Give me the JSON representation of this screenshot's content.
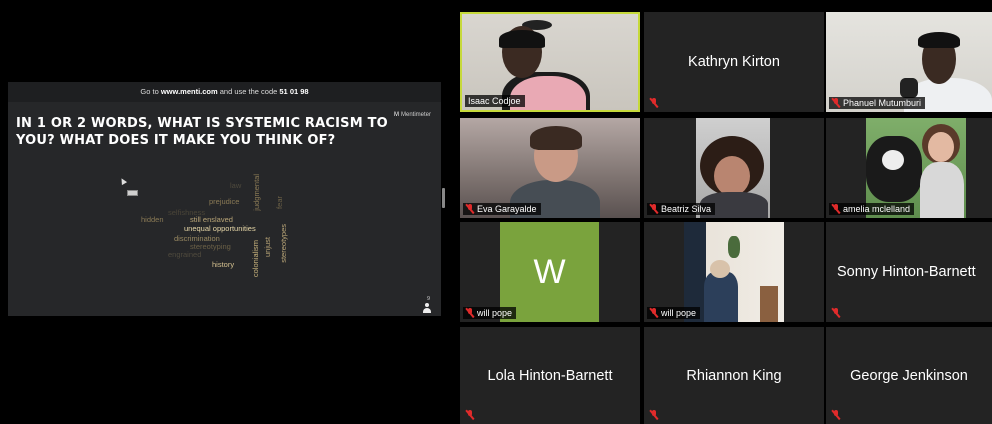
{
  "share": {
    "banner_prefix": "Go to ",
    "banner_url": "www.menti.com",
    "banner_mid": " and use the code ",
    "banner_code": "51 01 98",
    "logo_mark": "M",
    "logo_text": "Mentimeter",
    "question": "IN 1 OR 2 WORDS, WHAT IS SYSTEMIC RACISM TO YOU? WHAT DOES IT MAKE YOU THINK OF?",
    "response_count": "9",
    "word_cloud": [
      {
        "text": "law",
        "color": "#4f4a3d",
        "vertical": false
      },
      {
        "text": "prejudice",
        "color": "#8a7a55",
        "vertical": false
      },
      {
        "text": "judgmental",
        "color": "#8a7a55",
        "vertical": true
      },
      {
        "text": "fear",
        "color": "#6b6046",
        "vertical": true
      },
      {
        "text": "selfishness",
        "color": "#4a4538",
        "vertical": false
      },
      {
        "text": "hidden",
        "color": "#8a7a55",
        "vertical": false
      },
      {
        "text": "still enslaved",
        "color": "#b9a577",
        "vertical": false
      },
      {
        "text": "unequal opportunities",
        "color": "#e8d8a8",
        "vertical": false
      },
      {
        "text": "discrimination",
        "color": "#9a8a62",
        "vertical": false
      },
      {
        "text": "stereotyping",
        "color": "#6b6046",
        "vertical": false
      },
      {
        "text": "engrained",
        "color": "#4f4a3d",
        "vertical": false
      },
      {
        "text": "colonialism",
        "color": "#c8b37c",
        "vertical": true
      },
      {
        "text": "unjust",
        "color": "#b9a577",
        "vertical": true
      },
      {
        "text": "stereotypes",
        "color": "#b9a577",
        "vertical": true
      },
      {
        "text": "history",
        "color": "#d4c190",
        "vertical": false
      }
    ]
  },
  "participants": [
    {
      "name": "Isaac Codjoe",
      "video": true,
      "active": true,
      "muted": false
    },
    {
      "name": "Kathryn Kirton",
      "video": false,
      "muted": true
    },
    {
      "name": "Phanuel Mutumburi",
      "video": true,
      "muted": true
    },
    {
      "name": "Eva Garayalde",
      "video": true,
      "muted": true
    },
    {
      "name": "Beatriz Silva",
      "video": true,
      "muted": true
    },
    {
      "name": "amelia mclelland",
      "video": true,
      "muted": true
    },
    {
      "name": "will pope",
      "video": false,
      "avatar_letter": "W",
      "muted": true
    },
    {
      "name": "will pope",
      "video": true,
      "muted": true
    },
    {
      "name": "Sonny Hinton-Barnett",
      "video": false,
      "muted": true
    },
    {
      "name": "Lola Hinton-Barnett",
      "video": false,
      "muted": true
    },
    {
      "name": "Rhiannon King",
      "video": false,
      "muted": true
    },
    {
      "name": "George Jenkinson",
      "video": false,
      "muted": true
    }
  ],
  "colors": {
    "active_speaker_border": "#c6d93b",
    "tile_bg": "#232323",
    "mute_red": "#e02b2b",
    "avatar_green": "#7aa33d"
  }
}
